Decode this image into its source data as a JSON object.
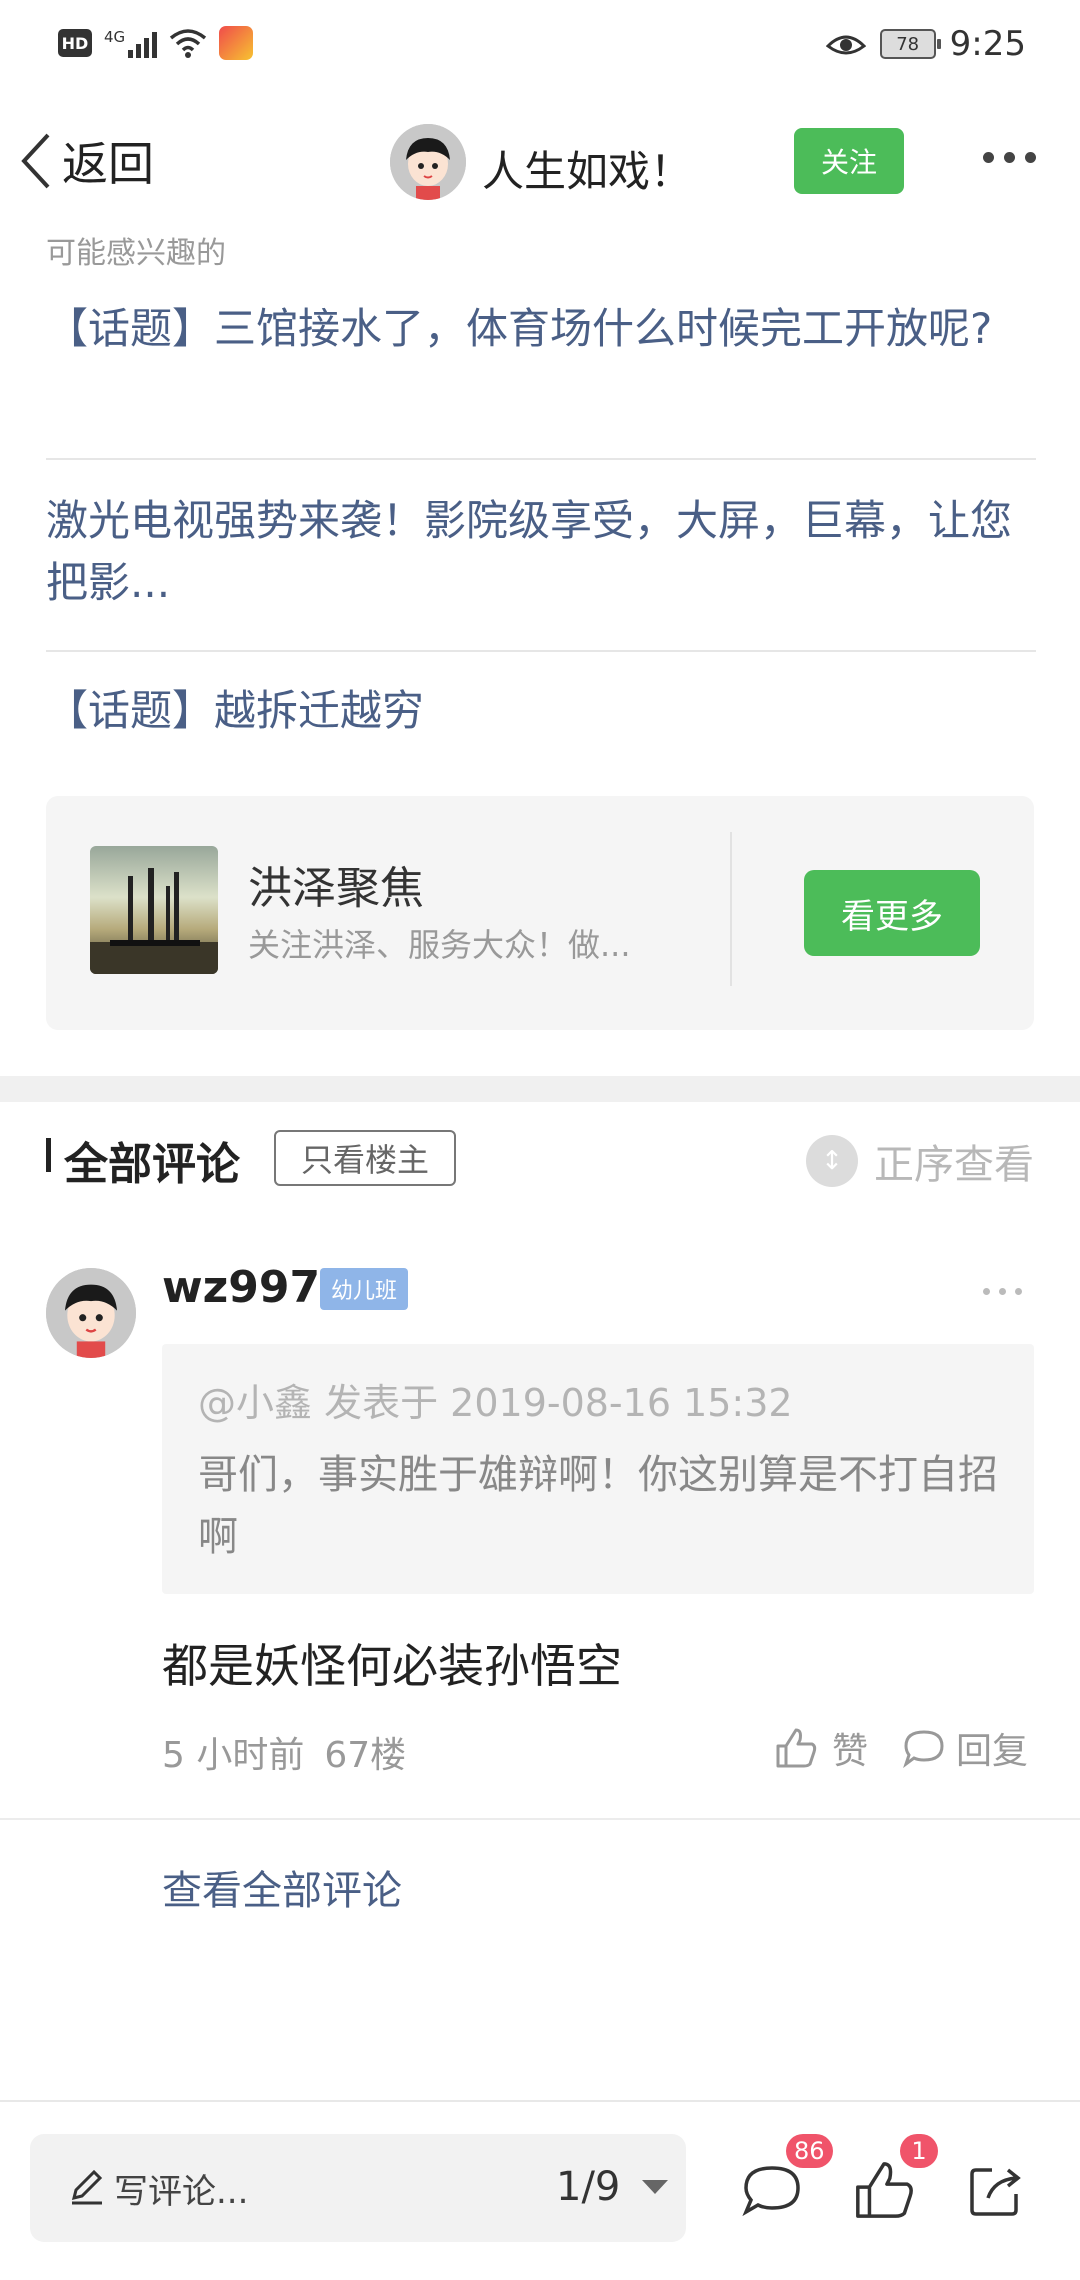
{
  "status_bar": {
    "time": "9:25",
    "battery": "78",
    "network": "4G",
    "hd": "HD"
  },
  "header": {
    "back_label": "返回",
    "author": "人生如戏！",
    "follow_label": "关注"
  },
  "related": {
    "section_label": "可能感兴趣的",
    "items": [
      "【话题】三馆接水了，体育场什么时候完工开放呢?",
      "激光电视强势来袭！影院级享受，大屏，巨幕，让您把影...",
      "【话题】越拆迁越穷"
    ]
  },
  "channel_card": {
    "title": "洪泽聚焦",
    "description": "关注洪泽、服务大众！做...",
    "button_label": "看更多"
  },
  "comments": {
    "title": "全部评论",
    "only_owner_label": "只看楼主",
    "order_label": "正序查看",
    "items": [
      {
        "username": "wz997",
        "badge": "幼儿班",
        "quote_header": "@小鑫 发表于 2019-08-16 15:32",
        "quote_text": "哥们，事实胜于雄辩啊！你这别算是不打自招啊",
        "content": "都是妖怪何必装孙悟空",
        "time": "5 小时前",
        "floor": "67楼",
        "like_label": "赞",
        "reply_label": "回复"
      }
    ],
    "view_all_label": "查看全部评论"
  },
  "bottom_bar": {
    "input_placeholder": "写评论...",
    "page_indicator": "1/9",
    "comment_count": "86",
    "like_count": "1"
  },
  "colors": {
    "accent_green": "#4cbc59",
    "link_blue": "#4a5f86",
    "badge_red": "#f0546a",
    "level_badge_blue": "#8fb5e8"
  }
}
